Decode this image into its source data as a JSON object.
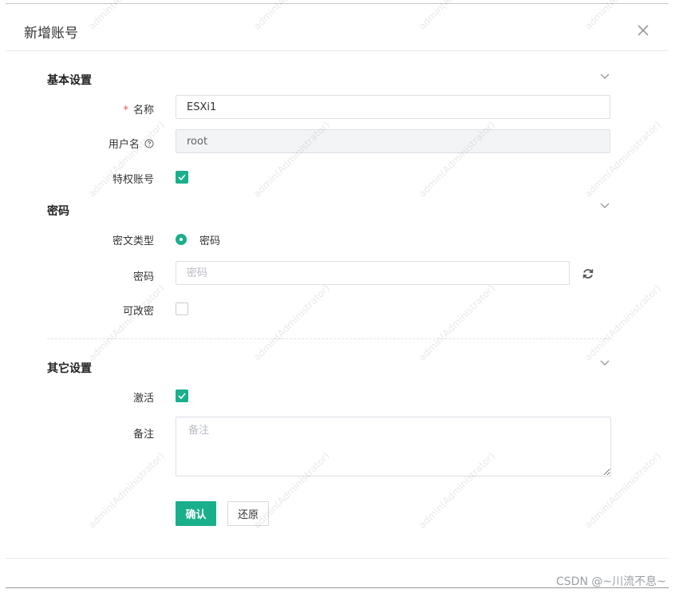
{
  "dialog": {
    "title": "新增账号",
    "close_icon": "close-icon"
  },
  "sections": {
    "basic": {
      "title": "基本设置"
    },
    "password": {
      "title": "密码"
    },
    "other": {
      "title": "其它设置"
    }
  },
  "fields": {
    "name": {
      "required_mark": "*",
      "label": "名称",
      "value": "ESXi1"
    },
    "username": {
      "label": "用户名",
      "help_icon": "question-circle-icon",
      "value": "root"
    },
    "privileged": {
      "label": "特权账号",
      "checked": true
    },
    "cipher_type": {
      "label": "密文类型",
      "option": "密码",
      "selected": true
    },
    "password": {
      "label": "密码",
      "placeholder": "密码",
      "refresh_icon": "refresh-icon"
    },
    "changeable": {
      "label": "可改密",
      "checked": false
    },
    "active": {
      "label": "激活",
      "checked": true
    },
    "remark": {
      "label": "备注",
      "placeholder": "备注"
    }
  },
  "buttons": {
    "confirm": "确认",
    "reset": "还原"
  },
  "watermark_text": "admin(Administrator)",
  "footer_credit": "CSDN @~川流不息~",
  "colors": {
    "accent": "#1aaf8b",
    "required": "#e2574c"
  }
}
